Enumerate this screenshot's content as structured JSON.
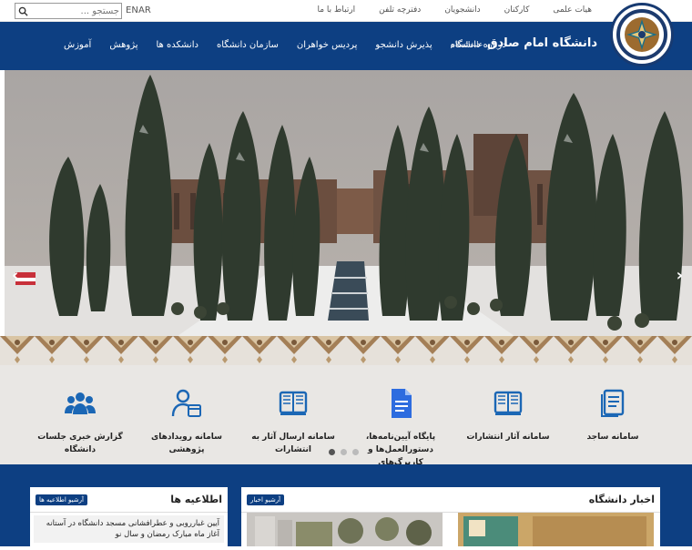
{
  "topbar": {
    "search_placeholder": "جستجو ...",
    "langs": [
      "EN",
      "AR"
    ],
    "links": [
      "هیات علمی",
      "کارکنان",
      "دانشجویان",
      "دفترچه تلفن",
      "ارتباط با ما"
    ]
  },
  "header": {
    "university_name": "دانشگاه امام صادق",
    "honorific": "علیه‌السلام",
    "menu": [
      "درباره دانشگاه",
      "پذیرش دانشجو",
      "پردیس خواهران",
      "سازمان دانشگاه",
      "دانشکده ها",
      "پژوهش",
      "آموزش"
    ]
  },
  "hero": {
    "prev_icon": "chevron-left-icon",
    "next_icon": "chevron-right-icon"
  },
  "services": [
    {
      "label": "سامانه ساجد",
      "icon": "document-icon"
    },
    {
      "label": "سامانه آثار انتشارات",
      "icon": "book-icon"
    },
    {
      "label": "پایگاه آیین‌نامه‌ها، دستورالعمل‌ها و کاربرگ‌های",
      "icon": "google-doc-icon"
    },
    {
      "label": "سامانه ارسال آثار به انتشارات",
      "icon": "book-icon"
    },
    {
      "label": "سامانه رویدادهای پژوهشی",
      "icon": "user-calendar-icon"
    },
    {
      "label": "گزارش خبری جلسات دانشگاه",
      "icon": "users-icon"
    }
  ],
  "news": {
    "title": "اخبار دانشگاه",
    "archive_label": "آرشیو اخبار"
  },
  "announcements": {
    "title": "اطلاعیه ها",
    "archive_label": "آرشیو اطلاعیه ها",
    "items": [
      "آیین غبارروبی و عطرافشانی مسجد دانشگاه در آستانه آغاز ماه مبارک رمضان و سال نو"
    ]
  },
  "colors": {
    "primary": "#0d3f82",
    "service_bg": "#e9e7e4",
    "icon_blue": "#1b67b5"
  }
}
